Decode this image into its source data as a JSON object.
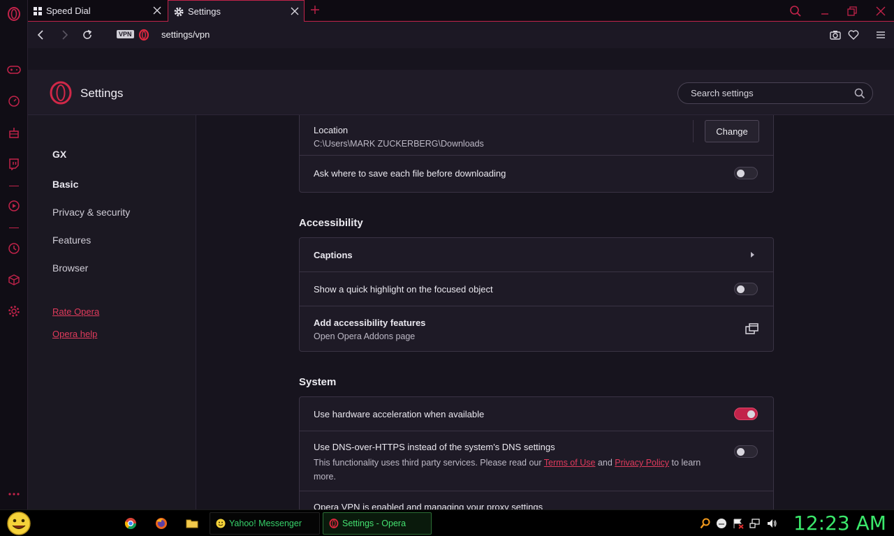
{
  "tabs": [
    {
      "label": "Speed Dial",
      "icon": "speed-dial-icon"
    },
    {
      "label": "Settings",
      "icon": "gear-icon"
    }
  ],
  "address": {
    "vpn_badge": "VPN",
    "url": "settings/vpn"
  },
  "header": {
    "title": "Settings",
    "search_placeholder": "Search settings"
  },
  "nav": {
    "items": [
      "GX",
      "Basic",
      "Privacy & security",
      "Features",
      "Browser"
    ],
    "links": [
      "Rate Opera",
      "Opera help"
    ]
  },
  "downloads": {
    "location_label": "Location",
    "location_path": "C:\\Users\\MARK ZUCKERBERG\\Downloads",
    "change_label": "Change",
    "ask_label": "Ask where to save each file before downloading",
    "ask_enabled": false
  },
  "accessibility": {
    "heading": "Accessibility",
    "captions_label": "Captions",
    "highlight_label": "Show a quick highlight on the focused object",
    "highlight_enabled": false,
    "addons_label": "Add accessibility features",
    "addons_sub": "Open Opera Addons page"
  },
  "system": {
    "heading": "System",
    "hw_label": "Use hardware acceleration when available",
    "hw_enabled": true,
    "dns_label": "Use DNS-over-HTTPS instead of the system's DNS settings",
    "dns_enabled": false,
    "dns_sub_pre": "This functionality uses third party services. Please read our",
    "dns_terms": "Terms of Use",
    "dns_and": "and",
    "dns_privacy": "Privacy Policy",
    "dns_to": "to",
    "dns_sub_end": "learn more.",
    "vpn_label": "Opera VPN is enabled and managing your proxy settings"
  },
  "taskbar": {
    "tasks": [
      "Yahoo! Messenger",
      "Settings - Opera"
    ],
    "clock": "12:23 AM"
  },
  "colors": {
    "accent": "#c2234a",
    "clock": "#3be86b"
  }
}
